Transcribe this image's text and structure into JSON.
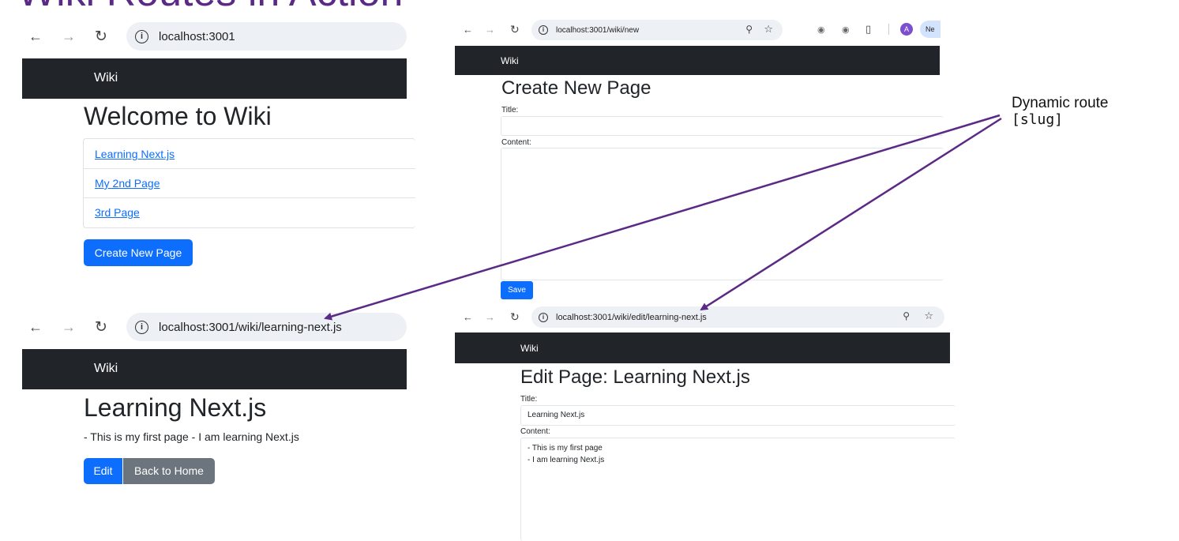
{
  "slide": {
    "title": "Wiki Routes in Action"
  },
  "annotation": {
    "line1": "Dynamic route",
    "line2": "[slug]"
  },
  "icons": {
    "back": "arrow-left-icon",
    "forward": "arrow-right-icon",
    "reload": "reload-icon",
    "info": "info-icon",
    "zoom": "zoom-icon",
    "star": "star-icon"
  },
  "colors": {
    "navbar": "#212529",
    "primary": "#0d6efd",
    "secondary": "#6c757d",
    "arrow": "#5b2a86"
  },
  "home": {
    "url": "localhost:3001",
    "brand": "Wiki",
    "heading": "Welcome to Wiki",
    "links": [
      "Learning Next.js",
      "My 2nd Page",
      "3rd Page"
    ],
    "create_button": "Create New Page"
  },
  "new_page": {
    "url": "localhost:3001/wiki/new",
    "brand": "Wiki",
    "heading": "Create New Page",
    "title_label": "Title:",
    "content_label": "Content:",
    "save_button": "Save",
    "profile_initial": "A",
    "profile_chip": "Ne"
  },
  "view_page": {
    "url": "localhost:3001/wiki/learning-next.js",
    "brand": "Wiki",
    "heading": "Learning Next.js",
    "body": "- This is my first page - I am learning Next.js",
    "edit_button": "Edit",
    "back_button": "Back to Home"
  },
  "edit_page": {
    "url": "localhost:3001/wiki/edit/learning-next.js",
    "brand": "Wiki",
    "heading": "Edit Page: Learning Next.js",
    "title_label": "Title:",
    "title_value": "Learning Next.js",
    "content_label": "Content:",
    "content_line1": "- This is my first page",
    "content_line2": "- I am learning Next.js"
  }
}
